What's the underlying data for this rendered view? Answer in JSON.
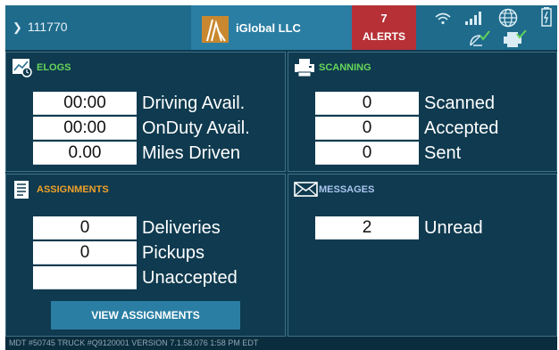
{
  "topbar": {
    "driver_id": "111770",
    "company_name": "iGlobal LLC",
    "alerts_count": "7",
    "alerts_label": "ALERTS"
  },
  "elogs": {
    "title": "ELOGS",
    "rows": [
      {
        "value": "00:00",
        "label": "Driving Avail."
      },
      {
        "value": "00:00",
        "label": "OnDuty Avail."
      },
      {
        "value": "0.00",
        "label": "Miles Driven"
      }
    ]
  },
  "scanning": {
    "title": "SCANNING",
    "rows": [
      {
        "value": "0",
        "label": "Scanned"
      },
      {
        "value": "0",
        "label": "Accepted"
      },
      {
        "value": "0",
        "label": "Sent"
      }
    ]
  },
  "assignments": {
    "title": "ASSIGNMENTS",
    "rows": [
      {
        "value": "0",
        "label": "Deliveries"
      },
      {
        "value": "0",
        "label": "Pickups"
      },
      {
        "value": "",
        "label": "Unaccepted"
      }
    ],
    "button_label": "VIEW ASSIGNMENTS"
  },
  "messages": {
    "title": "MESSAGES",
    "rows": [
      {
        "value": "2",
        "label": "Unread"
      }
    ]
  },
  "footer": {
    "text": "MDT #50745   TRUCK #Q9120001   VERSION  7.1.58.076   1:58 PM EDT"
  },
  "colors": {
    "background": "#0f3a4f",
    "topbar": "#1f6b8c",
    "alert": "#b63036",
    "elogs_title": "#66d65a",
    "scanning_title": "#66d65a",
    "assignments_title": "#f0a02a",
    "messages_title": "#a9c4ee"
  },
  "icons": [
    "chevron-right-icon",
    "company-logo",
    "wifi-icon",
    "signal-icon",
    "globe-icon",
    "battery-icon",
    "satellite-check-icon",
    "printer-check-icon",
    "elogs-chart-icon",
    "scanner-printer-icon",
    "assignments-document-icon",
    "envelope-icon"
  ]
}
